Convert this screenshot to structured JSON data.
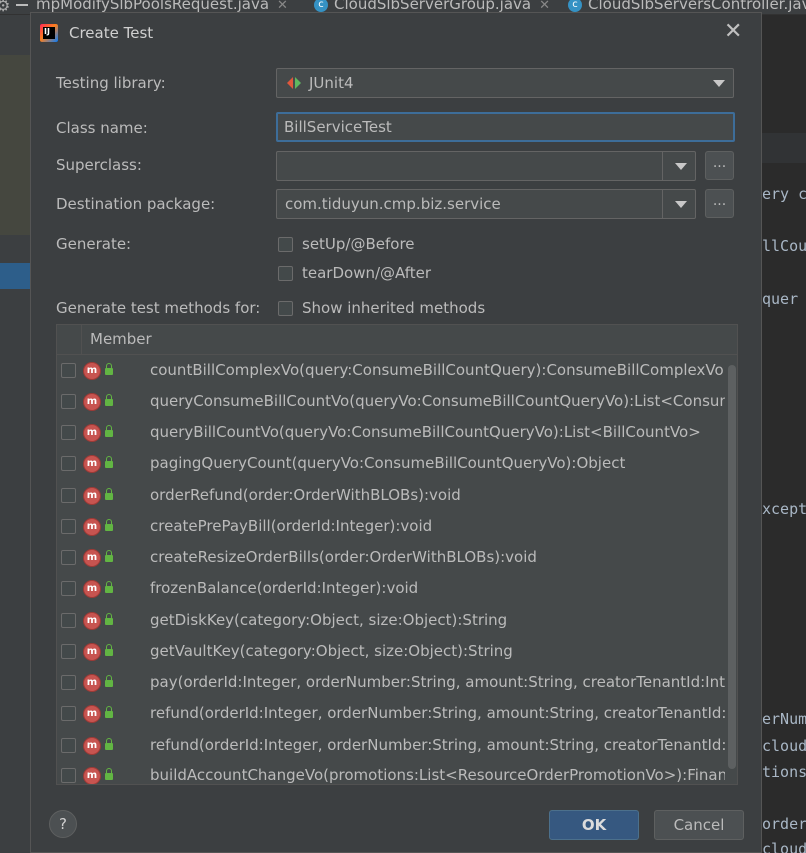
{
  "editor_tabs": [
    {
      "label": "mpModifySlbPoolsRequest.java"
    },
    {
      "label": "CloudSlbServerGroup.java"
    },
    {
      "label": "CloudSlbServersController.java"
    }
  ],
  "code_fragments": [
    "ery c",
    "llCou",
    " quer",
    "xcept",
    "erNum",
    "cloud",
    "tions",
    "order",
    "cloud"
  ],
  "dialog": {
    "title": "Create Test",
    "testing_library": {
      "label": "Testing library:",
      "value": "JUnit4"
    },
    "class_name": {
      "label": "Class name:",
      "value": "BillServiceTest"
    },
    "superclass": {
      "label": "Superclass:",
      "value": ""
    },
    "destination_package": {
      "label": "Destination package:",
      "value": "com.tiduyun.cmp.biz.service"
    },
    "browse_label": "...",
    "generate": {
      "label": "Generate:",
      "options": [
        {
          "label": "setUp/@Before",
          "checked": false
        },
        {
          "label": "tearDown/@After",
          "checked": false
        }
      ]
    },
    "generate_test_methods": {
      "label": "Generate test methods for:",
      "show_inherited": "Show inherited methods"
    },
    "table": {
      "header": "Member",
      "methods": [
        "countBillComplexVo(query:ConsumeBillCountQuery):ConsumeBillComplexVo",
        "queryConsumeBillCountVo(queryVo:ConsumeBillCountQueryVo):List<ConsumeBillCountVo>",
        "queryBillCountVo(queryVo:ConsumeBillCountQueryVo):List<BillCountVo>",
        "pagingQueryCount(queryVo:ConsumeBillCountQueryVo):Object",
        "orderRefund(order:OrderWithBLOBs):void",
        "createPrePayBill(orderId:Integer):void",
        "createResizeOrderBills(order:OrderWithBLOBs):void",
        "frozenBalance(orderId:Integer):void",
        "getDiskKey(category:Object, size:Object):String",
        "getVaultKey(category:Object, size:Object):String",
        "pay(orderId:Integer, orderNumber:String, amount:String, creatorTenantId:Integer):void",
        "refund(orderId:Integer, orderNumber:String, amount:String, creatorTenantId:Integer):void",
        "refund(orderId:Integer, orderNumber:String, amount:String, creatorTenantId:Integer):void",
        "buildAccountChangeVo(promotions:List<ResourceOrderPromotionVo>):FinanceAccountChangeVo"
      ],
      "member_icon": "m-icon",
      "access_icon": "lock-icon"
    },
    "buttons": {
      "help": "?",
      "ok": "OK",
      "cancel": "Cancel"
    }
  }
}
